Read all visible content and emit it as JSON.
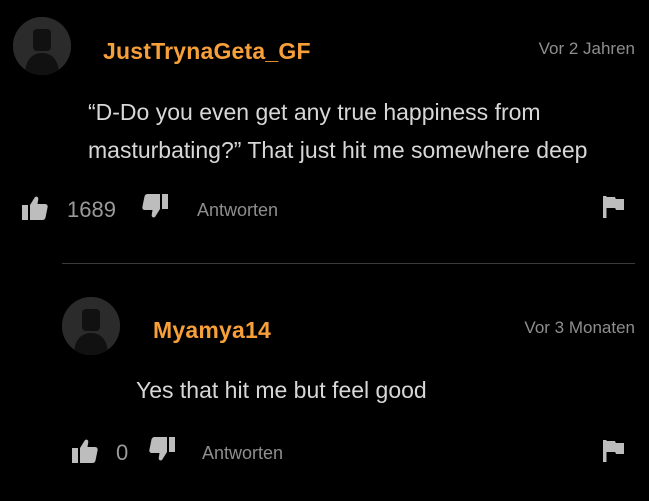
{
  "comments": [
    {
      "username": "JustTrynaGeta_GF",
      "timestamp": "Vor 2 Jahren",
      "text_lines": [
        "“D-Do you even get any true happiness from",
        "masturbating?” That just hit me somewhere deep"
      ],
      "likes": "1689",
      "reply_label": "Antworten"
    },
    {
      "username": "Myamya14",
      "timestamp": "Vor 3 Monaten",
      "text_lines": [
        "Yes that hit me but feel good"
      ],
      "likes": "0",
      "reply_label": "Antworten"
    }
  ],
  "colors": {
    "background": "#000000",
    "username": "#f7a03a",
    "text": "#d7d7d7",
    "meta": "#8e8e8e",
    "icon": "#bdbdbd"
  },
  "icons": [
    "avatar-placeholder-icon",
    "thumbs-up-icon",
    "thumbs-down-icon",
    "flag-icon"
  ]
}
